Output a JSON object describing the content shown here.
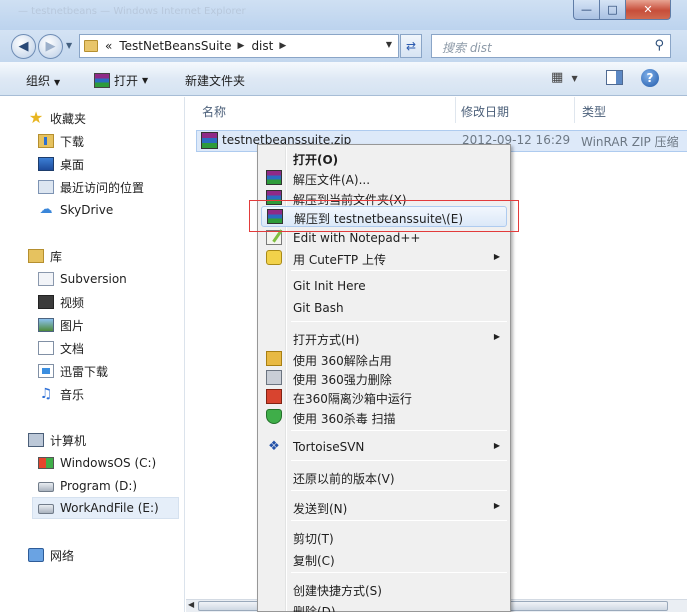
{
  "window": {
    "title_faded": "— testnetbeans — Windows Internet Explorer",
    "minimize_icon": "—",
    "maximize_icon": "□",
    "close_icon": "✕"
  },
  "address": {
    "overflow": "«",
    "segments": [
      "TestNetBeansSuite",
      "dist"
    ],
    "search_placeholder": "搜索 dist"
  },
  "toolbar": {
    "organize": "组织",
    "open": "打开",
    "new_folder": "新建文件夹",
    "help": "?"
  },
  "nav": {
    "favorites": "收藏夹",
    "fav_items": [
      "下载",
      "桌面",
      "最近访问的位置",
      "SkyDrive"
    ],
    "libraries": "库",
    "lib_items": [
      "Subversion",
      "视频",
      "图片",
      "文档",
      "迅雷下载",
      "音乐"
    ],
    "computer": "计算机",
    "drives": [
      "WindowsOS (C:)",
      "Program (D:)",
      "WorkAndFile (E:)"
    ],
    "network": "网络"
  },
  "columns": {
    "name": "名称",
    "modified": "修改日期",
    "type": "类型"
  },
  "file": {
    "name": "testnetbeanssuite.zip",
    "modified": "2012-09-12 16:29",
    "type": "WinRAR ZIP 压缩"
  },
  "context_menu": {
    "open": "打开(O)",
    "extract_files": "解压文件(A)...",
    "extract_here": "解压到当前文件夹(X)",
    "extract_to": "解压到 testnetbeanssuite\\(E)",
    "edit_notepad": "Edit with Notepad++",
    "cuteftp": "用 CuteFTP 上传",
    "git_init": "Git Init Here",
    "git_bash": "Git Bash",
    "open_with": "打开方式(H)",
    "unlock_360": "使用 360解除占用",
    "force_delete_360": "使用 360强力删除",
    "sandbox_360": "在360隔离沙箱中运行",
    "scan_360": "使用 360杀毒 扫描",
    "tortoise": "TortoiseSVN",
    "restore": "还原以前的版本(V)",
    "send_to": "发送到(N)",
    "cut": "剪切(T)",
    "copy": "复制(C)",
    "create_shortcut": "创建快捷方式(S)",
    "delete": "删除(D)"
  }
}
